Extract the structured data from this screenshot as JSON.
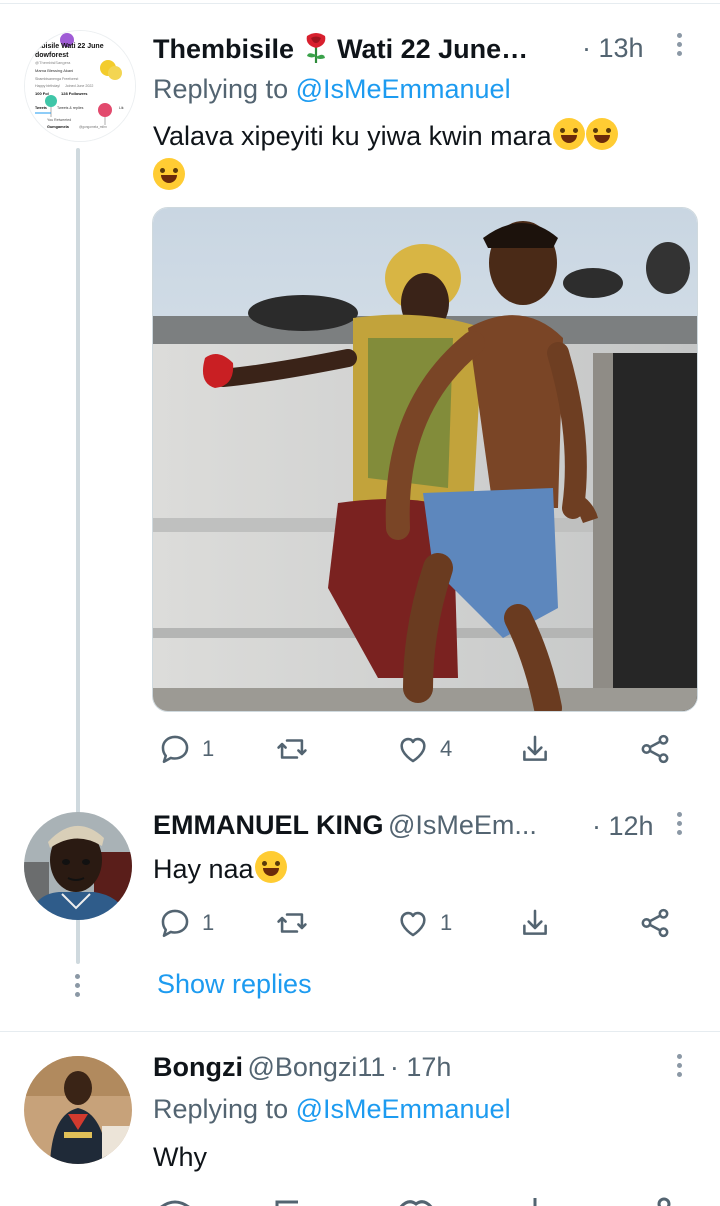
{
  "tweet1": {
    "name": "Thembisile",
    "name_rest": "Wati 22 June…",
    "time": "· 13h",
    "replying_prefix": "Replying to ",
    "replying_handle": "@IsMeEmmanuel",
    "text": "Valava xipeyiti ku yiwa kwin mara",
    "avatar_lines": [
      "mbisile Wati 22 June",
      "dowforest",
      "@ThembisiSangera",
      "Mama Blessing Akani",
      "Sbambisanenga Freeforest",
      "Happy birthday!",
      "Joined June 2022",
      "100 Fol",
      "128 Followers",
      "Tweets",
      "Tweets & replies",
      "Lik",
      "You Retweeted",
      "Gumgamela",
      "@gongomela_mthn"
    ],
    "replies": "1",
    "likes": "4"
  },
  "tweet2": {
    "name": "EMMANUEL KING",
    "handle": "@IsMeEm...",
    "time": "· 12h",
    "text": "Hay naa",
    "replies": "1",
    "likes": "1"
  },
  "show_replies": "Show replies",
  "tweet3": {
    "name": "Bongzi",
    "handle": "@Bongzi11",
    "time": "· 17h",
    "replying_prefix": "Replying to ",
    "replying_handle": "@IsMeEmmanuel",
    "text": "Why"
  },
  "colors": {
    "accent": "#1d9bf0",
    "secondary_text": "#536471",
    "thread_line": "#cfd9de"
  },
  "icons": [
    "reply-icon",
    "retweet-icon",
    "like-icon",
    "share-icon",
    "share-network-icon",
    "more-icon",
    "rose-emoji",
    "laughing-tears-emoji",
    "sweat-smile-emoji"
  ]
}
